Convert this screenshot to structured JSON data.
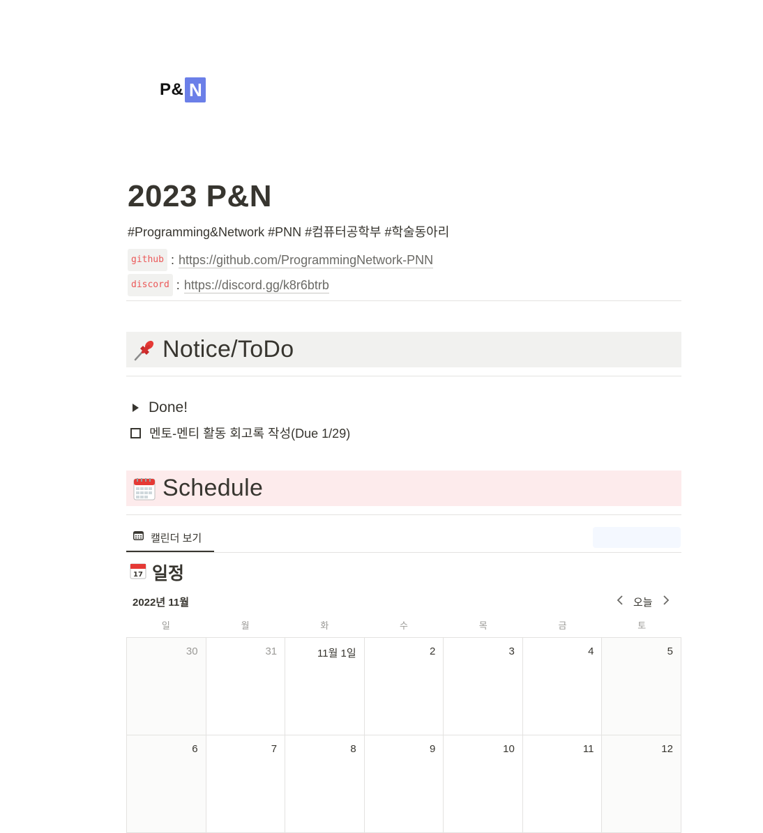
{
  "logo": {
    "text": "P&",
    "accent": "N",
    "accent_color": "#6b7fe8"
  },
  "page": {
    "title": "2023 P&N",
    "tags": "#Programming&Network #PNN #컴퓨터공학부 #학술동아리"
  },
  "links": [
    {
      "code": "github",
      "sep": ":",
      "url": "https://github.com/ProgrammingNetwork-PNN"
    },
    {
      "code": "discord",
      "sep": ":",
      "url": "https://discord.gg/k8r6btrb"
    }
  ],
  "notice": {
    "heading": "Notice/ToDo",
    "icon": "pushpin-icon",
    "toggle_label": "Done!",
    "todo_label": "멘토-멘티 활동 회고록 작성(Due 1/29)",
    "todo_checked": false
  },
  "schedule": {
    "heading": "Schedule",
    "icon": "calendar-icon",
    "view_tab": "캘린더 보기",
    "db_title": "일정",
    "month_label": "2022년 11월",
    "today_label": "오늘",
    "weekdays": [
      "일",
      "월",
      "화",
      "수",
      "목",
      "금",
      "토"
    ],
    "weeks": [
      [
        "30",
        "31",
        "11월 1일",
        "2",
        "3",
        "4",
        "5"
      ],
      [
        "6",
        "7",
        "8",
        "9",
        "10",
        "11",
        "12"
      ]
    ]
  },
  "colors": {
    "text": "#37352f",
    "callout_gray": "#f1f1ef",
    "callout_red": "#fdebec",
    "code_red": "#eb5757",
    "muted": "#9b9a97"
  }
}
